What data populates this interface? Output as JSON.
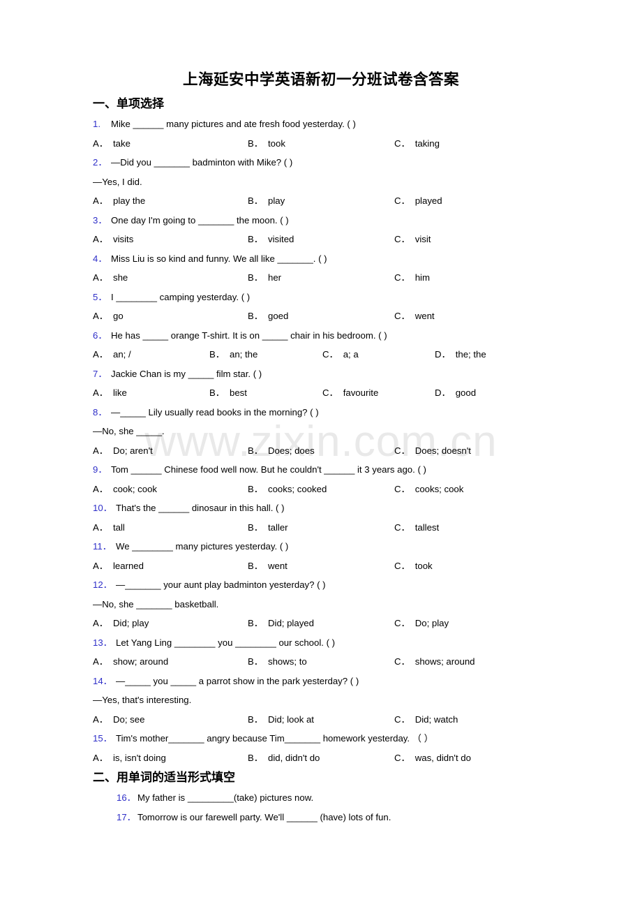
{
  "document": {
    "title": "上海延安中学英语新初一分班试卷含答案",
    "watermark": "www.zixin.com.cn"
  },
  "sections": [
    {
      "heading": "一、单项选择",
      "questions": [
        {
          "num": "1.",
          "text": "Mike ______ many pictures and ate fresh food yesterday. (  )",
          "continuation": null,
          "options": [
            {
              "letter": "A．",
              "text": "take"
            },
            {
              "letter": "B．",
              "text": "took"
            },
            {
              "letter": "C．",
              "text": "taking"
            }
          ]
        },
        {
          "num": "2．",
          "text": "—Did you _______ badminton with Mike? (  )",
          "continuation": "—Yes, I did.",
          "options": [
            {
              "letter": "A．",
              "text": "play the"
            },
            {
              "letter": "B．",
              "text": "play"
            },
            {
              "letter": "C．",
              "text": "played"
            }
          ]
        },
        {
          "num": "3．",
          "text": "One day I'm going to _______ the moon. (  )",
          "continuation": null,
          "options": [
            {
              "letter": "A．",
              "text": "visits"
            },
            {
              "letter": "B．",
              "text": "visited"
            },
            {
              "letter": "C．",
              "text": "visit"
            }
          ]
        },
        {
          "num": "4．",
          "text": "Miss Liu is so kind and funny. We all like _______. (  )",
          "continuation": null,
          "options": [
            {
              "letter": "A．",
              "text": "she"
            },
            {
              "letter": "B．",
              "text": "her"
            },
            {
              "letter": "C．",
              "text": "him"
            }
          ]
        },
        {
          "num": "5．",
          "text": "I ________ camping yesterday. (  )",
          "continuation": null,
          "options": [
            {
              "letter": "A．",
              "text": "go"
            },
            {
              "letter": "B．",
              "text": "goed"
            },
            {
              "letter": "C．",
              "text": "went"
            }
          ]
        },
        {
          "num": "6．",
          "text": "He has _____ orange T-shirt. It is on _____ chair in his bedroom. (  )",
          "continuation": null,
          "options": [
            {
              "letter": "A．",
              "text": "an; /"
            },
            {
              "letter": "B．",
              "text": "an; the"
            },
            {
              "letter": "C．",
              "text": "a; a"
            },
            {
              "letter": "D．",
              "text": "the; the"
            }
          ]
        },
        {
          "num": "7．",
          "text": "Jackie Chan is my _____ film star. (  )",
          "continuation": null,
          "options": [
            {
              "letter": "A．",
              "text": "like"
            },
            {
              "letter": "B．",
              "text": "best"
            },
            {
              "letter": "C．",
              "text": "favourite"
            },
            {
              "letter": "D．",
              "text": "good"
            }
          ]
        },
        {
          "num": "8．",
          "text": "—_____ Lily usually read books in the morning? (  )",
          "continuation": "—No, she _____.",
          "options": [
            {
              "letter": "A．",
              "text": "Do; aren't"
            },
            {
              "letter": "B．",
              "text": "Does; does"
            },
            {
              "letter": "C．",
              "text": "Does; doesn't"
            }
          ]
        },
        {
          "num": "9．",
          "text": "Tom ______ Chinese food well now. But he couldn't ______ it 3 years ago. (  )",
          "continuation": null,
          "options": [
            {
              "letter": "A．",
              "text": "cook; cook"
            },
            {
              "letter": "B．",
              "text": "cooks; cooked"
            },
            {
              "letter": "C．",
              "text": "cooks; cook"
            }
          ]
        },
        {
          "num": "10．",
          "text": "That's the ______ dinosaur in this hall. (  )",
          "continuation": null,
          "options": [
            {
              "letter": "A．",
              "text": "tall"
            },
            {
              "letter": "B．",
              "text": "taller"
            },
            {
              "letter": "C．",
              "text": "tallest"
            }
          ]
        },
        {
          "num": "11．",
          "text": "We ________ many pictures yesterday. (  )",
          "continuation": null,
          "options": [
            {
              "letter": "A．",
              "text": "learned"
            },
            {
              "letter": "B．",
              "text": "went"
            },
            {
              "letter": "C．",
              "text": "took"
            }
          ]
        },
        {
          "num": "12．",
          "text": "—_______ your aunt play badminton yesterday? (  )",
          "continuation": "—No, she _______ basketball.",
          "options": [
            {
              "letter": "A．",
              "text": "Did; play"
            },
            {
              "letter": "B．",
              "text": "Did; played"
            },
            {
              "letter": "C．",
              "text": "Do; play"
            }
          ]
        },
        {
          "num": "13．",
          "text": "Let Yang Ling ________ you ________ our school. (  )",
          "continuation": null,
          "options": [
            {
              "letter": "A．",
              "text": "show; around"
            },
            {
              "letter": "B．",
              "text": "shows; to"
            },
            {
              "letter": "C．",
              "text": "shows; around"
            }
          ]
        },
        {
          "num": "14．",
          "text": "—_____ you _____ a parrot show in the park yesterday? (  )",
          "continuation": "—Yes, that's interesting.",
          "options": [
            {
              "letter": "A．",
              "text": "Do; see"
            },
            {
              "letter": "B．",
              "text": "Did; look at"
            },
            {
              "letter": "C．",
              "text": "Did; watch"
            }
          ]
        },
        {
          "num": "15．",
          "text": "Tim's mother_______ angry because Tim_______ homework yesterday. （  ）",
          "continuation": null,
          "options": [
            {
              "letter": "A．",
              "text": "is, isn't doing"
            },
            {
              "letter": "B．",
              "text": "did, didn't do"
            },
            {
              "letter": "C．",
              "text": "was, didn't do"
            }
          ]
        }
      ]
    },
    {
      "heading": "二、用单词的适当形式填空",
      "fill_items": [
        {
          "num": "16．",
          "text": "My father is _________(take) pictures now."
        },
        {
          "num": "17．",
          "text": "Tomorrow is our farewell party. We'll ______ (have) lots of fun."
        }
      ]
    }
  ]
}
